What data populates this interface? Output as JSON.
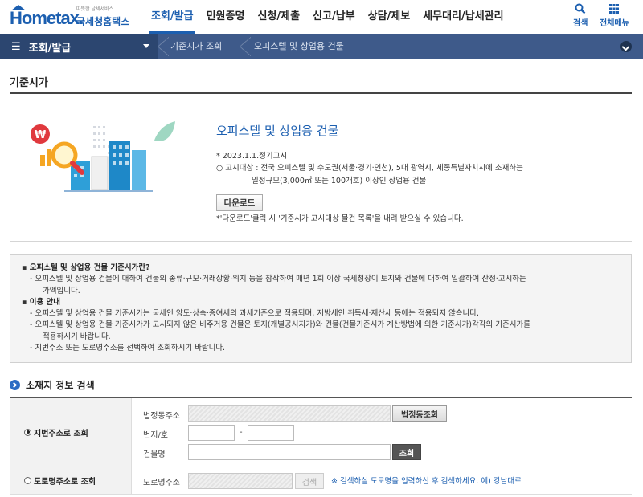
{
  "header": {
    "logo": {
      "brand": "Hometax.",
      "korean": "국세청홈택스",
      "tagline": "따뜻한 납세서비스"
    },
    "nav": [
      {
        "label": "조회/발급",
        "active": true
      },
      {
        "label": "민원증명",
        "active": false
      },
      {
        "label": "신청/제출",
        "active": false
      },
      {
        "label": "신고/납부",
        "active": false
      },
      {
        "label": "상담/제보",
        "active": false
      },
      {
        "label": "세무대리/납세관리",
        "active": false
      }
    ],
    "search_label": "검색",
    "allmenu_label": "전체메뉴"
  },
  "location": {
    "current_menu": "조회/발급",
    "breadcrumb": [
      "기준시가 조회",
      "오피스텔 및 상업용 건물"
    ]
  },
  "page": {
    "title": "기준시가"
  },
  "intro": {
    "heading": "오피스텔 및 상업용 건물",
    "date_note": "* 2023.1.1.정기고시",
    "target_line1": "○ 고시대상 : 전국 오피스텔 및 수도권(서울·경기·인천), 5대 광역시, 세종특별자치시에 소재하는",
    "target_line2": "일정규모(3,000㎡ 또는 100개호) 이상인 상업용 건물",
    "download_label": "다운로드",
    "download_note": "*'다운로드'클릭 시 '기준시가 고시대상 물건 목록'을 내려 받으실 수 있습니다."
  },
  "info": {
    "sec1_title": "오피스텔 및 상업용 건물 기준시가란?",
    "sec1_line1": "- 오피스텔 및 상업용 건물에 대하여 건물의 종류·규모·거래상황·위치 등을 참작하여 매년 1회 이상 국세청장이 토지와 건물에 대하여 일괄하여 산정·고시하는",
    "sec1_line2": "가액입니다.",
    "sec2_title": "이용 안내",
    "sec2_line1": "- 오피스텔 및 상업용 건물 기준시가는 국세인 양도·상속·증여세의 과세기준으로 적용되며, 지방세인 취득세·재산세 등에는 적용되지 않습니다.",
    "sec2_line2": "- 오피스텔 및 상업용 건물 기준시가가 고시되지 않은 비주거용 건물은 토지(개별공시지가)와 건물(건물기준시가 계산방법에 의한 기준시가)각각의 기준시가를",
    "sec2_line3": "적용하시기 바랍니다.",
    "sec2_line4": "- 지번주소 또는 도로명주소를 선택하여 조회하시기 바랍니다."
  },
  "search": {
    "heading": "소재지 정보 검색",
    "jibun": {
      "label": "지번주소로 조회",
      "selected": true,
      "legal_dong_label": "법정동주소",
      "legal_dong_value": "",
      "legal_dong_button": "법정동조회",
      "bunji_label": "번지/호",
      "bunji_value": "",
      "ho_value": "",
      "dash": "-",
      "building_label": "건물명",
      "building_value": "",
      "search_button": "조회"
    },
    "road": {
      "label": "도로명주소로 조회",
      "selected": false,
      "road_label": "도로명주소",
      "road_value": "",
      "search_button": "검색",
      "hint": "※ 검색하실 도로명을 입력하신 후 검색하세요. 예) 강남대로"
    }
  },
  "colors": {
    "primary": "#1c5fb0",
    "locbar": "#3e5a8a",
    "locbar_dark": "#2c4670"
  }
}
